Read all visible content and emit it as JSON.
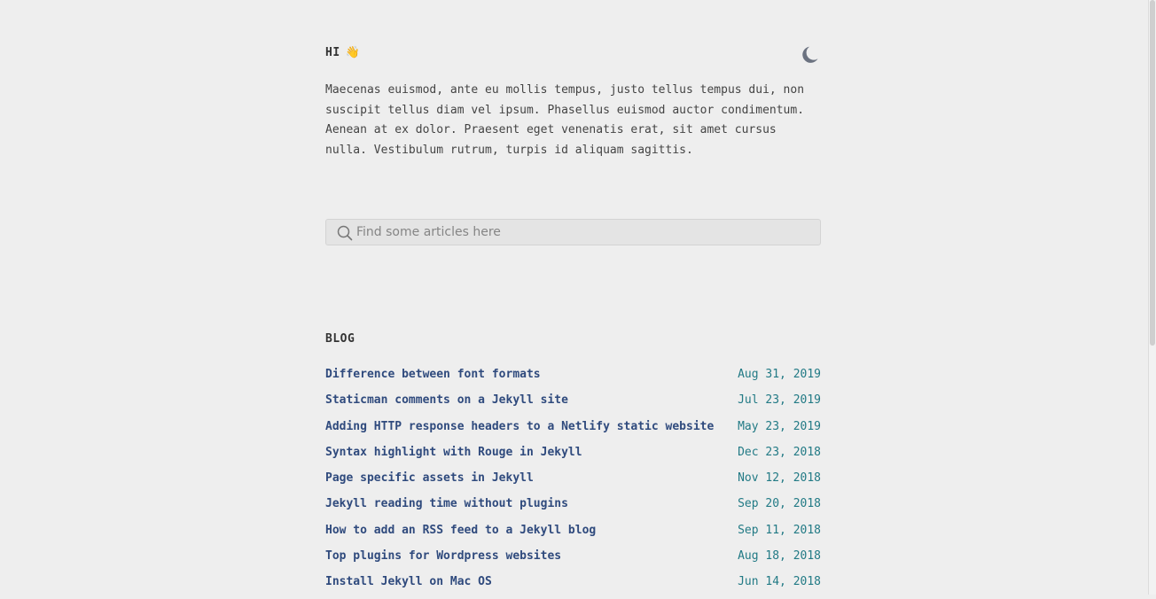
{
  "header": {
    "greeting": "HI",
    "wave_emoji": "👋",
    "theme_toggle_icon": "moon-icon"
  },
  "intro": {
    "text": "Maecenas euismod, ante eu mollis tempus, justo tellus tempus dui, non suscipit tellus diam vel ipsum. Phasellus euismod auctor condimentum. Aenean at ex dolor. Praesent eget venenatis erat, sit amet cursus nulla. Vestibulum rutrum, turpis id aliquam sagittis."
  },
  "search": {
    "placeholder": "Find some articles here",
    "value": "",
    "icon": "search-icon"
  },
  "blog": {
    "heading": "BLOG",
    "posts": [
      {
        "title": "Difference between font formats",
        "date": "Aug 31, 2019"
      },
      {
        "title": "Staticman comments on a Jekyll site",
        "date": "Jul 23, 2019"
      },
      {
        "title": "Adding HTTP response headers to a Netlify static website",
        "date": "May 23, 2019"
      },
      {
        "title": "Syntax highlight with Rouge in Jekyll",
        "date": "Dec 23, 2018"
      },
      {
        "title": "Page specific assets in Jekyll",
        "date": "Nov 12, 2018"
      },
      {
        "title": "Jekyll reading time without plugins",
        "date": "Sep 20, 2018"
      },
      {
        "title": "How to add an RSS feed to a Jekyll blog",
        "date": "Sep 11, 2018"
      },
      {
        "title": "Top plugins for Wordpress websites",
        "date": "Aug 18, 2018"
      },
      {
        "title": "Install Jekyll on Mac OS",
        "date": "Jun 14, 2018"
      }
    ]
  },
  "colors": {
    "background": "#eeeeee",
    "text": "#333333",
    "link": "#2f4a7d",
    "date": "#227a85",
    "icon": "#6b7280"
  }
}
